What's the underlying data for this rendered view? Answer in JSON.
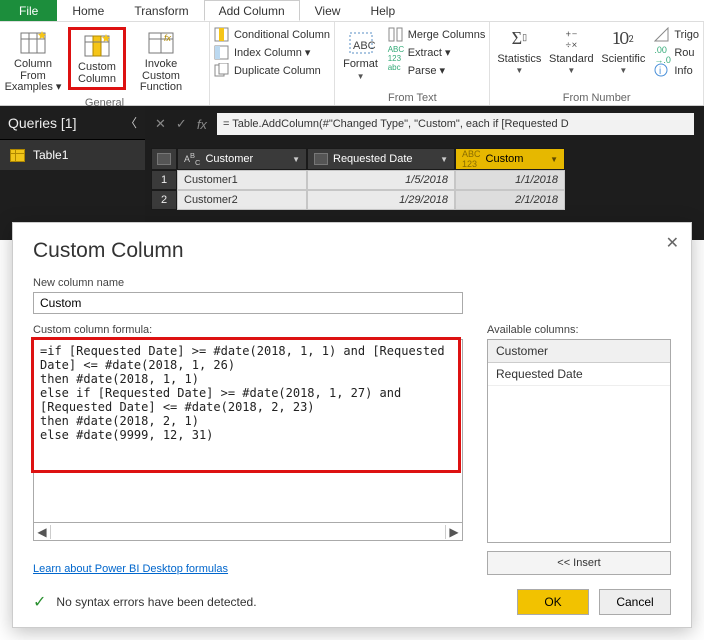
{
  "menu": {
    "file": "File",
    "home": "Home",
    "transform": "Transform",
    "addcol": "Add Column",
    "view": "View",
    "help": "Help"
  },
  "ribbon": {
    "g1": {
      "colFromExamples": "Column From Examples ▾",
      "custom": "Custom Column",
      "invoke": "Invoke Custom Function",
      "label": "General"
    },
    "g2": {
      "cond": "Conditional Column",
      "index": "Index Column ▾",
      "dup": "Duplicate Column"
    },
    "g3": {
      "format": "Format",
      "merge": "Merge Columns",
      "extract": "Extract ▾",
      "parse": "Parse ▾",
      "label": "From Text"
    },
    "g4": {
      "stats": "Statistics",
      "standard": "Standard",
      "sci": "Scientific",
      "trig": "Trigo",
      "round": "Rou",
      "info": "Info",
      "label": "From Number"
    }
  },
  "queries": {
    "title": "Queries [1]",
    "item": "Table1"
  },
  "formula": "= Table.AddColumn(#\"Changed Type\", \"Custom\", each if [Requested D",
  "cols": {
    "c1": "Customer",
    "c2": "Requested Date",
    "c3": "Custom"
  },
  "rows": [
    {
      "n": "1",
      "c1": "Customer1",
      "c2": "1/5/2018",
      "c3": "1/1/2018"
    },
    {
      "n": "2",
      "c1": "Customer2",
      "c2": "1/29/2018",
      "c3": "2/1/2018"
    }
  ],
  "dialog": {
    "title": "Custom Column",
    "nameLabel": "New column name",
    "nameValue": "Custom",
    "formulaLabel": "Custom column formula:",
    "formula": "=if [Requested Date] >= #date(2018, 1, 1) and [Requested Date] <= #date(2018, 1, 26)\nthen #date(2018, 1, 1)\nelse if [Requested Date] >= #date(2018, 1, 27) and [Requested Date] <= #date(2018, 2, 23)\nthen #date(2018, 2, 1)\nelse #date(9999, 12, 31)",
    "link": "Learn about Power BI Desktop formulas",
    "availLabel": "Available columns:",
    "avail": [
      "Customer",
      "Requested Date"
    ],
    "insert": "<< Insert",
    "status": "No syntax errors have been detected.",
    "ok": "OK",
    "cancel": "Cancel"
  }
}
